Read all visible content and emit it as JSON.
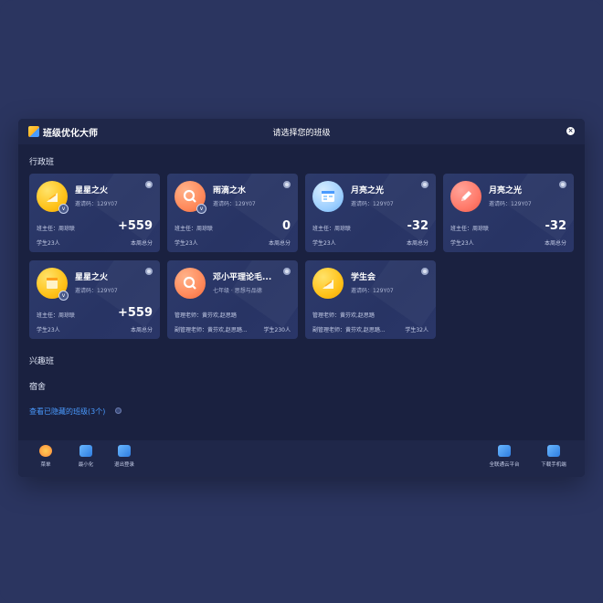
{
  "app": {
    "name": "班级优化大师",
    "window_title": "请选择您的班级",
    "close_icon": "close-icon"
  },
  "sections": {
    "admin": "行政班",
    "interest": "兴趣班",
    "dorm": "宿舍"
  },
  "cards": [
    {
      "name": "星星之火",
      "sub": "邀请码：129Y07",
      "row1_left": "班主任：周琼联",
      "score": "+559",
      "row2_left": "学生23人",
      "row2_right": "本周总分",
      "avatar": "flag-icon"
    },
    {
      "name": "雨滴之水",
      "sub": "邀请码：129Y07",
      "row1_left": "班主任：周琼联",
      "score": "0",
      "row2_left": "学生23人",
      "row2_right": "本周总分",
      "avatar": "magnifier-icon"
    },
    {
      "name": "月亮之光",
      "sub": "邀请码：129Y07",
      "row1_left": "班主任：周琼联",
      "score": "-32",
      "row2_left": "学生23人",
      "row2_right": "本周总分",
      "avatar": "calendar-icon"
    },
    {
      "name": "月亮之光",
      "sub": "邀请码：129Y07",
      "row1_left": "班主任：周琼联",
      "score": "-32",
      "row2_left": "学生23人",
      "row2_right": "本周总分",
      "avatar": "pencil-icon"
    },
    {
      "name": "星星之火",
      "sub": "邀请码：129Y07",
      "row1_left": "班主任：周琼联",
      "score": "+559",
      "row2_left": "学生23人",
      "row2_right": "本周总分",
      "avatar": "box-icon"
    },
    {
      "name": "邓小平理论毛...",
      "sub": "七年级 · 思想与品德",
      "row1_left": "管理老师：黄芬欢,赵思踏",
      "row2_left": "副管理老师：黄芬欢,赵思踏...",
      "row2_right": "学生230人",
      "avatar": "magnifier-icon"
    },
    {
      "name": "学生会",
      "sub": "邀请码：129Y07",
      "row1_left": "管理老师：黄芬欢,赵思踏",
      "row2_left": "副管理老师：黄芬欢,赵思踏...",
      "row2_right": "学生32人",
      "avatar": "flag-icon"
    }
  ],
  "hidden_link": "查看已隐藏的班级(3个)",
  "toolbar": {
    "menu": "菜单",
    "minimize": "最小化",
    "logout": "退出登录",
    "platform": "全联通云平台",
    "mobile": "下载手机端"
  },
  "colors": {
    "accent": "#4a9bff",
    "window_bg": "#1a2140",
    "card_bg": "#2d3a6b",
    "page_bg": "#2b3560"
  }
}
